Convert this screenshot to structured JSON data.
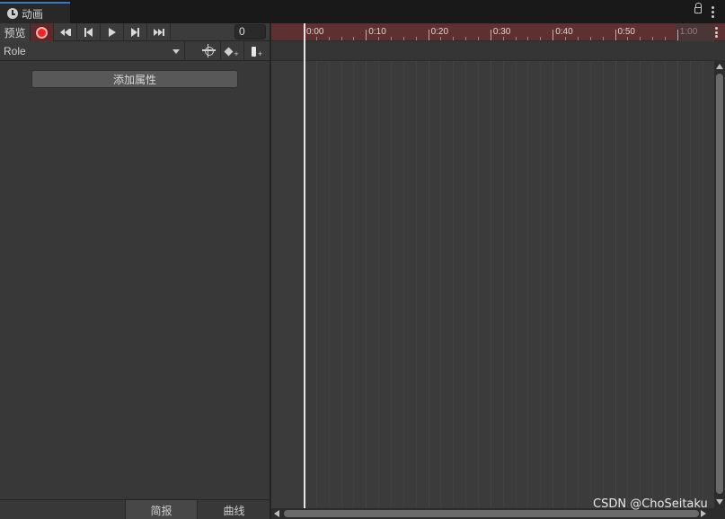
{
  "window": {
    "tab_title": "动画",
    "tab_icon": "clock-icon"
  },
  "toolbar": {
    "preview_label": "预览",
    "frame_value": "0"
  },
  "clip": {
    "selected": "Role"
  },
  "properties": {
    "add_property_label": "添加属性"
  },
  "bottom_tabs": {
    "summary_label": "简报",
    "curves_label": "曲线"
  },
  "timeline": {
    "ruler_labels": [
      "0:00",
      "0:10",
      "0:20",
      "0:30",
      "0:40",
      "0:50",
      "1:00"
    ],
    "range_color": "#5f3030"
  },
  "watermark": "CSDN @ChoSeitaku"
}
